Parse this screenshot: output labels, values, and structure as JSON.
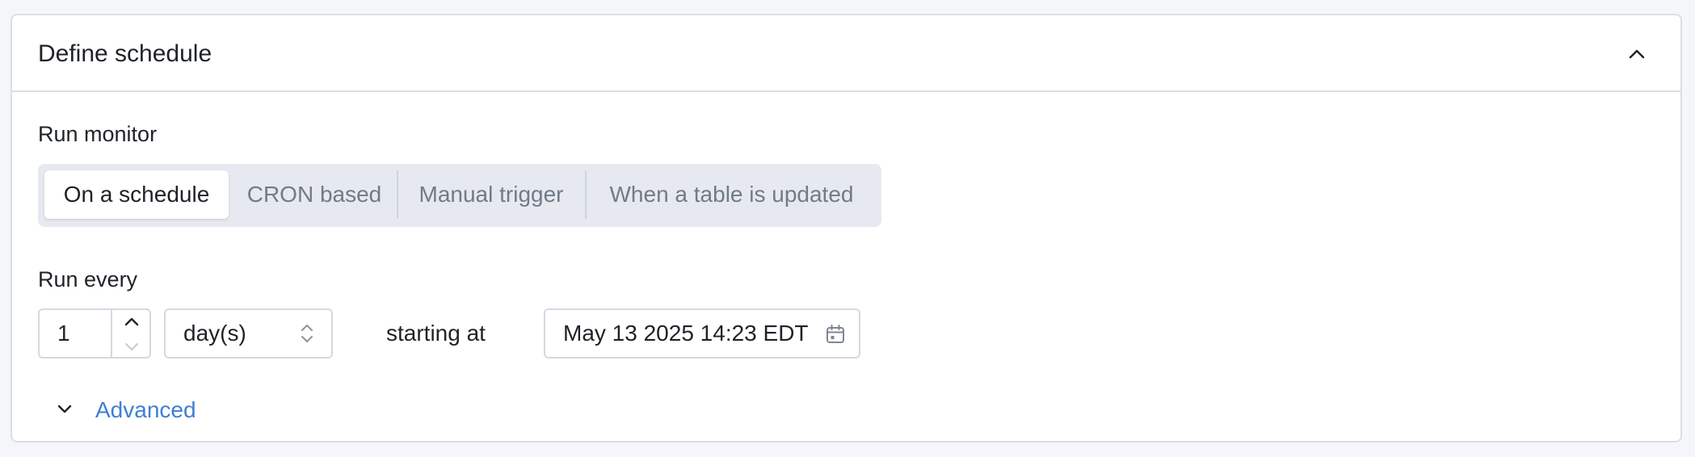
{
  "header": {
    "title": "Define schedule",
    "collapse_icon": "chevron-up-icon"
  },
  "run_monitor": {
    "label": "Run monitor",
    "options": [
      {
        "label": "On a schedule",
        "selected": true
      },
      {
        "label": "CRON based",
        "selected": false
      },
      {
        "label": "Manual trigger",
        "selected": false
      },
      {
        "label": "When a table is updated",
        "selected": false
      }
    ]
  },
  "run_every": {
    "label": "Run every",
    "interval_value": "1",
    "unit_value": "day(s)",
    "starting_at_label": "starting at",
    "start_datetime": "May 13 2025 14:23 EDT",
    "calendar_icon": "calendar-icon"
  },
  "advanced": {
    "label": "Advanced",
    "toggle_icon": "chevron-down-icon"
  },
  "colors": {
    "background": "#f5f6fa",
    "card": "#ffffff",
    "border": "#d9dee6",
    "segment_bg": "#e6eaf0",
    "muted_text": "#717b88",
    "link": "#3f7fd1"
  }
}
